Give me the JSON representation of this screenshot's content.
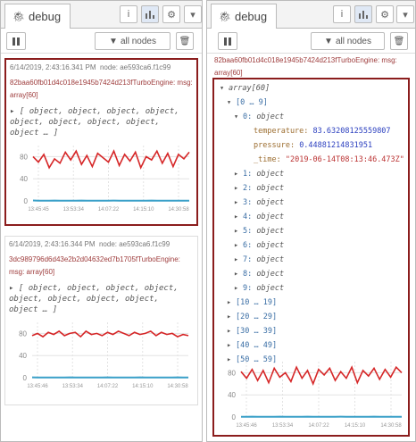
{
  "debug_tab_label": "debug",
  "toolbar": {
    "filter_label": "all nodes"
  },
  "left": {
    "messages": [
      {
        "timestamp": "6/14/2019, 2:43:16.341 PM",
        "node": "node: ae593ca6.f1c99",
        "topic": "82baa60fb01d4c018e1945b7424d213fTurboEngine: msg: array[60]",
        "preview_lines": [
          "object, object, object, object,",
          "object, object, object, object,",
          "object … ]"
        ],
        "selected": true,
        "chart_data": {
          "type": "line",
          "yticks": [
            "80",
            "40",
            "0"
          ],
          "ylim": [
            0,
            100
          ],
          "xticks": [
            "13:45:45",
            "13:53:34",
            "14:07:22",
            "14:15:10",
            "14:30:58"
          ],
          "series": [
            {
              "color": "#d62728",
              "values": [
                80,
                70,
                84,
                60,
                76,
                68,
                88,
                74,
                90,
                66,
                82,
                62,
                86,
                78,
                70,
                90,
                64,
                84,
                72,
                88,
                60,
                80,
                74,
                90,
                68,
                86,
                62,
                84,
                76,
                88
              ]
            },
            {
              "color": "#3aa0c8",
              "values": [
                0.8,
                0.4,
                0.5,
                0.3,
                0.6,
                0.4,
                0.5,
                0.3,
                0.4,
                0.6,
                0.5,
                0.4,
                0.3,
                0.5,
                0.4,
                0.6,
                0.3,
                0.5,
                0.4,
                0.5,
                0.4,
                0.3,
                0.6,
                0.4,
                0.5,
                0.3,
                0.4,
                0.5,
                0.4,
                0.5
              ]
            }
          ]
        }
      },
      {
        "timestamp": "6/14/2019, 2:43:16.344 PM",
        "node": "node: ae593ca6.f1c99",
        "topic": "3dc989796d6d43e2b2d04632ed7b1705fTurboEngine: msg: array[60]",
        "preview_lines": [
          "object, object, object, object,",
          "object, object, object, object,",
          "object … ]"
        ],
        "selected": false,
        "chart_data": {
          "type": "line",
          "yticks": [
            "80",
            "40",
            "0"
          ],
          "ylim": [
            0,
            100
          ],
          "xticks": [
            "13:45:46",
            "13:53:34",
            "14:07:22",
            "14:15:10",
            "14:30:58"
          ],
          "series": [
            {
              "color": "#d62728",
              "values": [
                76,
                80,
                74,
                82,
                78,
                84,
                76,
                80,
                82,
                74,
                84,
                78,
                80,
                76,
                82,
                78,
                84,
                80,
                76,
                82,
                78,
                80,
                84,
                76,
                82,
                78,
                80,
                74,
                78,
                76
              ]
            },
            {
              "color": "#3aa0c8",
              "values": [
                0.6,
                0.5,
                0.4,
                0.5,
                0.3,
                0.5,
                0.4,
                0.6,
                0.5,
                0.4,
                0.5,
                0.3,
                0.4,
                0.5,
                0.6,
                0.4,
                0.5,
                0.3,
                0.4,
                0.5,
                0.6,
                0.4,
                0.5,
                0.4,
                0.3,
                0.5,
                0.4,
                0.6,
                0.5,
                0.4
              ]
            }
          ]
        }
      }
    ]
  },
  "right": {
    "topic": "82baa60fb01d4c018e1945b7424d213fTurboEngine: msg: array[60]",
    "tree": {
      "root": "array[60]",
      "group0": "[0 … 9]",
      "item0": {
        "index": "0:",
        "type": "object",
        "fields": [
          {
            "key": "temperature:",
            "value": "83.63208125559807",
            "kind": "num"
          },
          {
            "key": "pressure:",
            "value": "0.44881214831951",
            "kind": "num"
          },
          {
            "key": "_time:",
            "value": "\"2019-06-14T08:13:46.473Z\"",
            "kind": "str"
          }
        ]
      },
      "items": [
        {
          "index": "1:",
          "type": "object"
        },
        {
          "index": "2:",
          "type": "object"
        },
        {
          "index": "3:",
          "type": "object"
        },
        {
          "index": "4:",
          "type": "object"
        },
        {
          "index": "5:",
          "type": "object"
        },
        {
          "index": "6:",
          "type": "object"
        },
        {
          "index": "7:",
          "type": "object"
        },
        {
          "index": "8:",
          "type": "object"
        },
        {
          "index": "9:",
          "type": "object"
        }
      ],
      "ranges": [
        "[10 … 19]",
        "[20 … 29]",
        "[30 … 39]",
        "[40 … 49]",
        "[50 … 59]"
      ]
    },
    "chart_data": {
      "type": "line",
      "yticks": [
        "80",
        "40",
        "0"
      ],
      "ylim": [
        0,
        100
      ],
      "xticks": [
        "13:45:46",
        "13:53:34",
        "14:07:22",
        "14:15:10",
        "14:30:58"
      ],
      "series": [
        {
          "color": "#d62728",
          "values": [
            82,
            70,
            86,
            66,
            84,
            62,
            88,
            72,
            80,
            64,
            90,
            70,
            84,
            60,
            86,
            76,
            88,
            66,
            82,
            70,
            90,
            62,
            84,
            74,
            88,
            68,
            86,
            72,
            90,
            80
          ]
        },
        {
          "color": "#3aa0c8",
          "values": [
            0.5,
            0.4,
            0.6,
            0.3,
            0.5,
            0.4,
            0.5,
            0.6,
            0.3,
            0.4,
            0.5,
            0.4,
            0.6,
            0.3,
            0.5,
            0.4,
            0.5,
            0.3,
            0.6,
            0.4,
            0.5,
            0.4,
            0.3,
            0.5,
            0.6,
            0.4,
            0.5,
            0.3,
            0.4,
            0.5
          ]
        }
      ]
    }
  }
}
